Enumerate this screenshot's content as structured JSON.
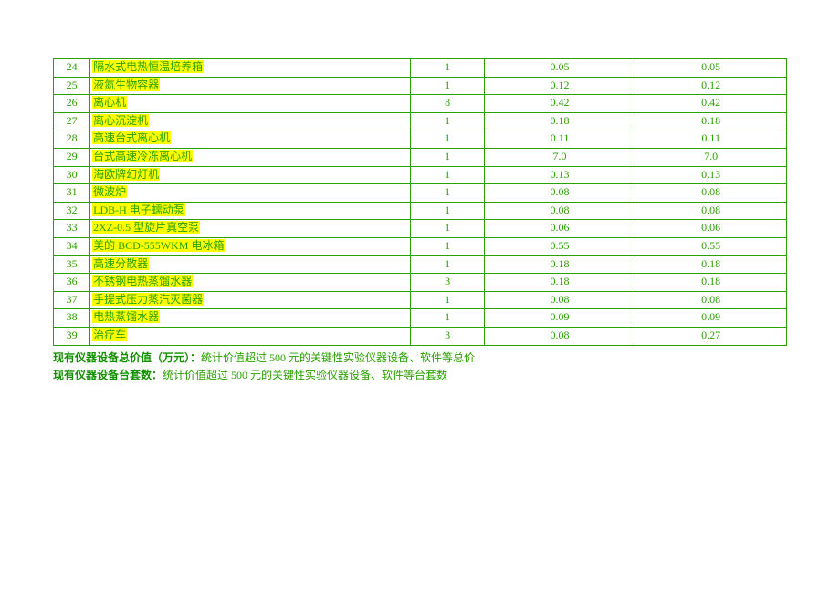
{
  "rows": [
    {
      "idx": "24",
      "name": "隔水式电热恒温培养箱",
      "qty": "1",
      "unit": "0.05",
      "total": "0.05"
    },
    {
      "idx": "25",
      "name": "液氮生物容器",
      "qty": "1",
      "unit": "0.12",
      "total": "0.12"
    },
    {
      "idx": "26",
      "name": "离心机",
      "qty": "8",
      "unit": "0.42",
      "total": "0.42"
    },
    {
      "idx": "27",
      "name": "离心沉淀机",
      "qty": "1",
      "unit": "0.18",
      "total": "0.18"
    },
    {
      "idx": "28",
      "name": "高速台式离心机",
      "qty": "1",
      "unit": "0.11",
      "total": "0.11"
    },
    {
      "idx": "29",
      "name": "台式高速冷冻离心机",
      "qty": "1",
      "unit": "7.0",
      "total": "7.0"
    },
    {
      "idx": "30",
      "name": "海欧牌幻灯机",
      "qty": "1",
      "unit": "0.13",
      "total": "0.13"
    },
    {
      "idx": "31",
      "name": "微波炉",
      "qty": "1",
      "unit": "0.08",
      "total": "0.08"
    },
    {
      "idx": "32",
      "name": "LDB-H 电子蠕动泵",
      "qty": "1",
      "unit": "0.08",
      "total": "0.08"
    },
    {
      "idx": "33",
      "name": "2XZ-0.5 型旋片真空泵",
      "qty": "1",
      "unit": "0.06",
      "total": "0.06"
    },
    {
      "idx": "34",
      "name": "美的 BCD-555WKM 电冰箱",
      "qty": "1",
      "unit": "0.55",
      "total": "0.55"
    },
    {
      "idx": "35",
      "name": "高速分散器",
      "qty": "1",
      "unit": "0.18",
      "total": "0.18"
    },
    {
      "idx": "36",
      "name": "不锈钢电热蒸馏水器",
      "qty": "3",
      "unit": "0.18",
      "total": "0.18"
    },
    {
      "idx": "37",
      "name": "手提式压力蒸汽灭菌器",
      "qty": "1",
      "unit": "0.08",
      "total": "0.08"
    },
    {
      "idx": "38",
      "name": "电热蒸馏水器",
      "qty": "1",
      "unit": "0.09",
      "total": "0.09"
    },
    {
      "idx": "39",
      "name": "治疗车",
      "qty": "3",
      "unit": "0.08",
      "total": "0.27"
    }
  ],
  "notes": {
    "line1": {
      "label": "现有仪器设备总价值（万元）：",
      "desc": "统计价值超过 500 元的关键性实验仪器设备、软件等总价"
    },
    "line2": {
      "label": "现有仪器设备台套数：",
      "desc": "统计价值超过 500 元的关键性实验仪器设备、软件等台套数"
    }
  }
}
